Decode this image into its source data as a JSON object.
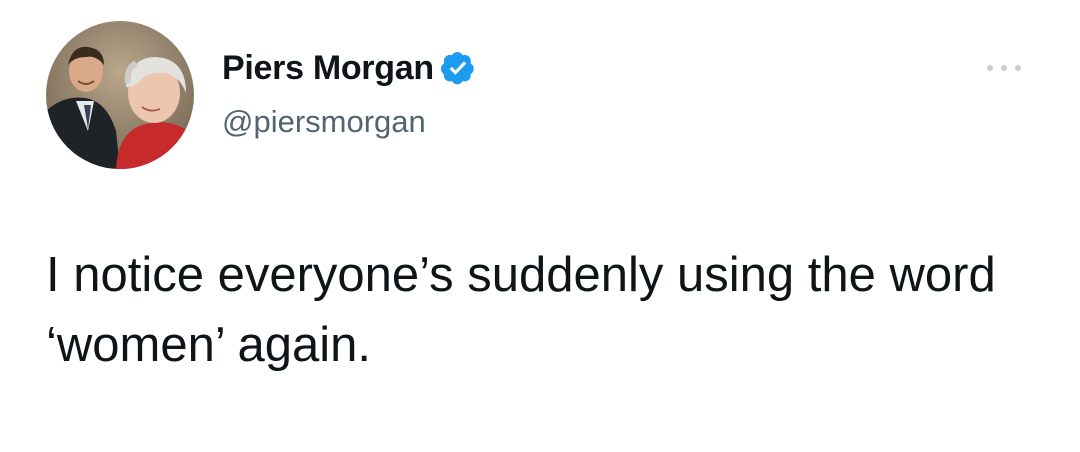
{
  "tweet": {
    "author": {
      "display_name": "Piers Morgan",
      "handle": "@piersmorgan",
      "verified": true,
      "avatar_icon": "profile-photo"
    },
    "more_icon": "more-options-icon",
    "text": "I notice everyone’s suddenly using the word ‘women’ again."
  },
  "colors": {
    "verified_badge": "#1d9bf0",
    "handle_gray": "#536471",
    "text": "#0f1419"
  }
}
